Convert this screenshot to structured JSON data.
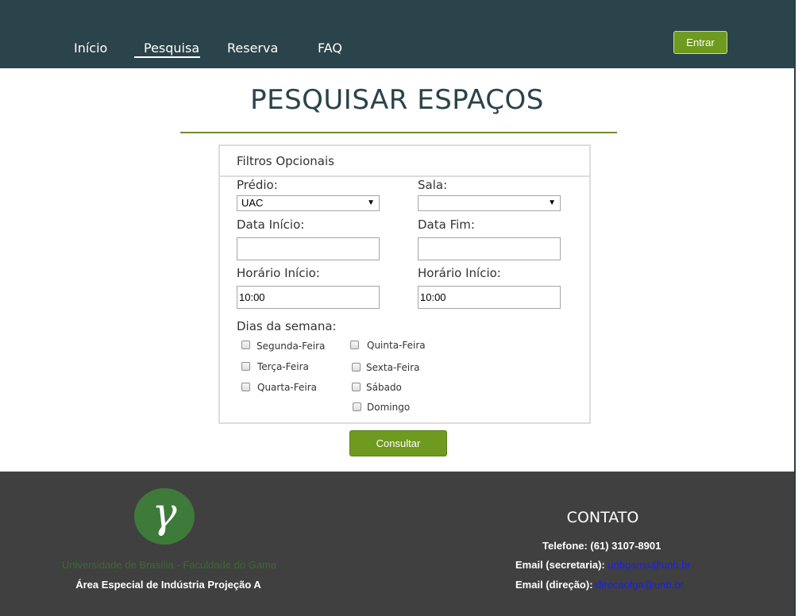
{
  "nav": {
    "items": [
      {
        "label": "Início"
      },
      {
        "label": "Pesquisa",
        "active": true
      },
      {
        "label": "Reserva"
      },
      {
        "label": "FAQ"
      }
    ],
    "login_label": "Entrar"
  },
  "page": {
    "title": "PESQUISAR ESPAÇOS"
  },
  "filters": {
    "panel_title": "Filtros Opcionais",
    "predio": {
      "label": "Prédio:",
      "value": "UAC"
    },
    "sala": {
      "label": "Sala:",
      "value": ""
    },
    "data_inicio": {
      "label": "Data Início:",
      "value": ""
    },
    "data_fim": {
      "label": "Data Fim:",
      "value": ""
    },
    "horario_inicio": {
      "label": "Horário Início:",
      "value": "10:00"
    },
    "horario_fim": {
      "label": "Horário Início:",
      "value": "10:00"
    },
    "dias_label": "Dias da semana:",
    "dias": [
      {
        "label": "Segunda-Feira",
        "checked": false
      },
      {
        "label": "Terça-Feira",
        "checked": false
      },
      {
        "label": "Quarta-Feira",
        "checked": false
      },
      {
        "label": "Quinta-Feira",
        "checked": false
      },
      {
        "label": "Sexta-Feira",
        "checked": false
      },
      {
        "label": "Sábado",
        "checked": false
      },
      {
        "label": "Domingo",
        "checked": false
      }
    ],
    "submit_label": "Consultar"
  },
  "footer": {
    "logo_glyph": "γ",
    "university": "Universidade de Brasília - Faculdade do Gama",
    "address": "Área Especial de Indústria Projeção A",
    "contact_title": "CONTATO",
    "phone_label": "Telefone: (61) 3107-8901",
    "email_secretaria_label": "Email (secretaria):",
    "email_secretaria": "unbgama@unb.br",
    "email_direcao_label": "Email (direção):",
    "email_direcao": "direcaofga@unb.br"
  },
  "colors": {
    "navbar": "#2b434a",
    "accent_green": "#6e9a1f",
    "footer": "#404040",
    "link": "#1a1aff"
  }
}
